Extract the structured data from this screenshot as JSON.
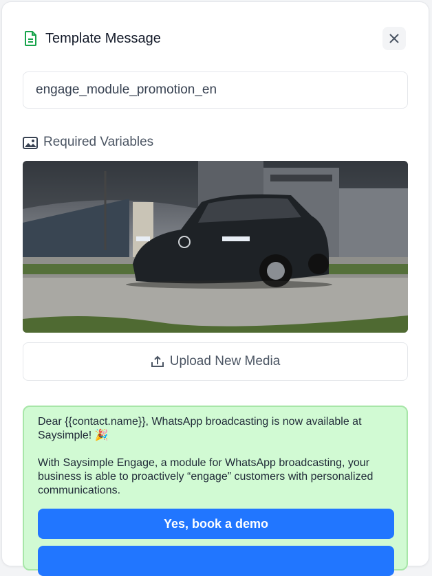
{
  "header": {
    "title": "Template Message",
    "icon": "document-icon",
    "close_icon": "close-icon"
  },
  "template": {
    "name": "engage_module_promotion_en"
  },
  "variables": {
    "label": "Required Variables",
    "icon": "image-icon"
  },
  "media": {
    "description_icon": "photo-preview"
  },
  "upload": {
    "label": "Upload New Media",
    "icon": "upload-icon"
  },
  "message": {
    "body": "Dear {{contact.name}}, WhatsApp broadcasting is now available at Saysimple! 🎉\n\nWith Saysimple Engage, a module for WhatsApp broadcasting, your business is able to proactively “engage” customers with personalized communications.",
    "buttons": [
      {
        "label": "Yes, book a demo"
      },
      {
        "label": ""
      }
    ]
  },
  "colors": {
    "accent": "#2176ff",
    "bubble": "#d1fad3",
    "doc_icon": "#16a34a"
  }
}
